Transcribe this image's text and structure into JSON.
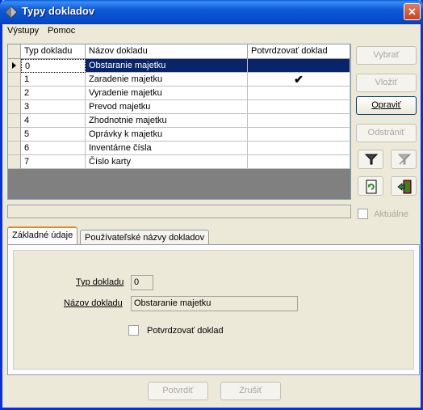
{
  "window": {
    "title": "Typy dokladov"
  },
  "menu": {
    "items": [
      "Výstupy",
      "Pomoc"
    ]
  },
  "grid": {
    "columns": [
      "Typ dokladu",
      "Názov dokladu",
      "Potvrdzovať doklad"
    ],
    "rows": [
      {
        "typ": "0",
        "nazov": "Obstaranie majetku",
        "potvrdzovat": false,
        "selected": true
      },
      {
        "typ": "1",
        "nazov": "Zaradenie majetku",
        "potvrdzovat": true
      },
      {
        "typ": "2",
        "nazov": "Vyradenie majetku",
        "potvrdzovat": false
      },
      {
        "typ": "3",
        "nazov": "Prevod majetku",
        "potvrdzovat": false
      },
      {
        "typ": "4",
        "nazov": "Zhodnotnie majetku",
        "potvrdzovat": false
      },
      {
        "typ": "5",
        "nazov": "Oprávky k majetku",
        "potvrdzovat": false
      },
      {
        "typ": "6",
        "nazov": "Inventárne čísla",
        "potvrdzovat": false
      },
      {
        "typ": "7",
        "nazov": "Číslo karty",
        "potvrdzovat": false
      }
    ],
    "check_glyph": "✔"
  },
  "buttons": {
    "vybrat": "Vybrať",
    "vlozit": "Vložiť",
    "opravit": "Opraviť",
    "odstranit": "Odstrániť",
    "potvrdit": "Potvrdiť",
    "zrusit": "Zrušiť"
  },
  "aktualne": {
    "label": "Aktuálne",
    "checked": false
  },
  "tabs": [
    "Základné údaje",
    "Používateľské názvy dokladov"
  ],
  "form": {
    "typ_label": "Typ dokladu",
    "typ_value": "0",
    "nazov_label": "Názov dokladu",
    "nazov_value": "Obstaranie majetku",
    "potvrdzovat_label": "Potvrdzovať doklad"
  },
  "colors": {
    "selection": "#0a246a",
    "title_bar": "#0a5bdc",
    "disabled_text": "#aca899"
  }
}
